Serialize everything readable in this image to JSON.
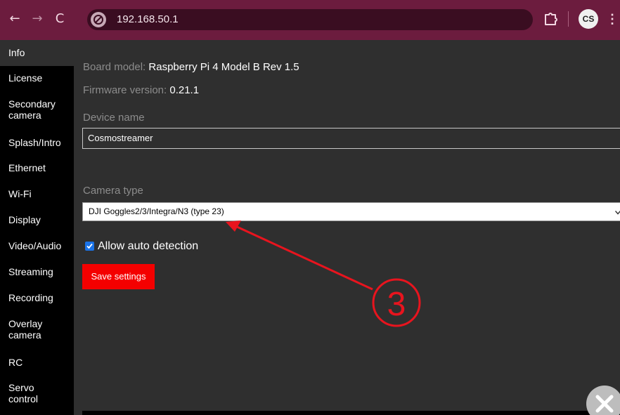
{
  "browser": {
    "url": "192.168.50.1",
    "profile_initials": "CS",
    "back_glyph": "←",
    "forward_glyph": "→",
    "reload_glyph": "C",
    "menu_glyph": "⋮"
  },
  "sidebar": {
    "items": [
      {
        "label": "Info",
        "active": true
      },
      {
        "label": "License"
      },
      {
        "label": "Secondary camera"
      },
      {
        "label": "Splash/Intro"
      },
      {
        "label": "Ethernet"
      },
      {
        "label": "Wi-Fi"
      },
      {
        "label": "Display"
      },
      {
        "label": "Video/Audio"
      },
      {
        "label": "Streaming"
      },
      {
        "label": "Recording"
      },
      {
        "label": "Overlay camera"
      },
      {
        "label": "RC"
      },
      {
        "label": "Servo control"
      }
    ]
  },
  "main": {
    "board_model_label": "Board model:",
    "board_model_value": "Raspberry Pi 4 Model B Rev 1.5",
    "firmware_label": "Firmware version:",
    "firmware_value": "0.21.1",
    "device_name_label": "Device name",
    "device_name_value": "Cosmostreamer",
    "camera_type_label": "Camera type",
    "camera_type_value": "DJI Goggles2/3/Integra/N3 (type 23)",
    "auto_detect_label": "Allow auto detection",
    "auto_detect_checked": true,
    "save_button_label": "Save settings"
  },
  "annotation": {
    "marker_number": "3",
    "color": "#e8141e"
  },
  "colors": {
    "chrome": "#6c1c3e",
    "sidebar": "#000000",
    "content": "#2f2f2f",
    "save_button": "#f40000",
    "checkbox": "#1a73e8"
  },
  "icons": {
    "back": "arrow-left-icon",
    "forward": "arrow-right-icon",
    "reload": "reload-icon",
    "site": "site-info-icon",
    "extensions": "puzzle-icon",
    "menu": "kebab-menu-icon",
    "close": "close-icon",
    "checkbox": "checkmark-icon"
  }
}
